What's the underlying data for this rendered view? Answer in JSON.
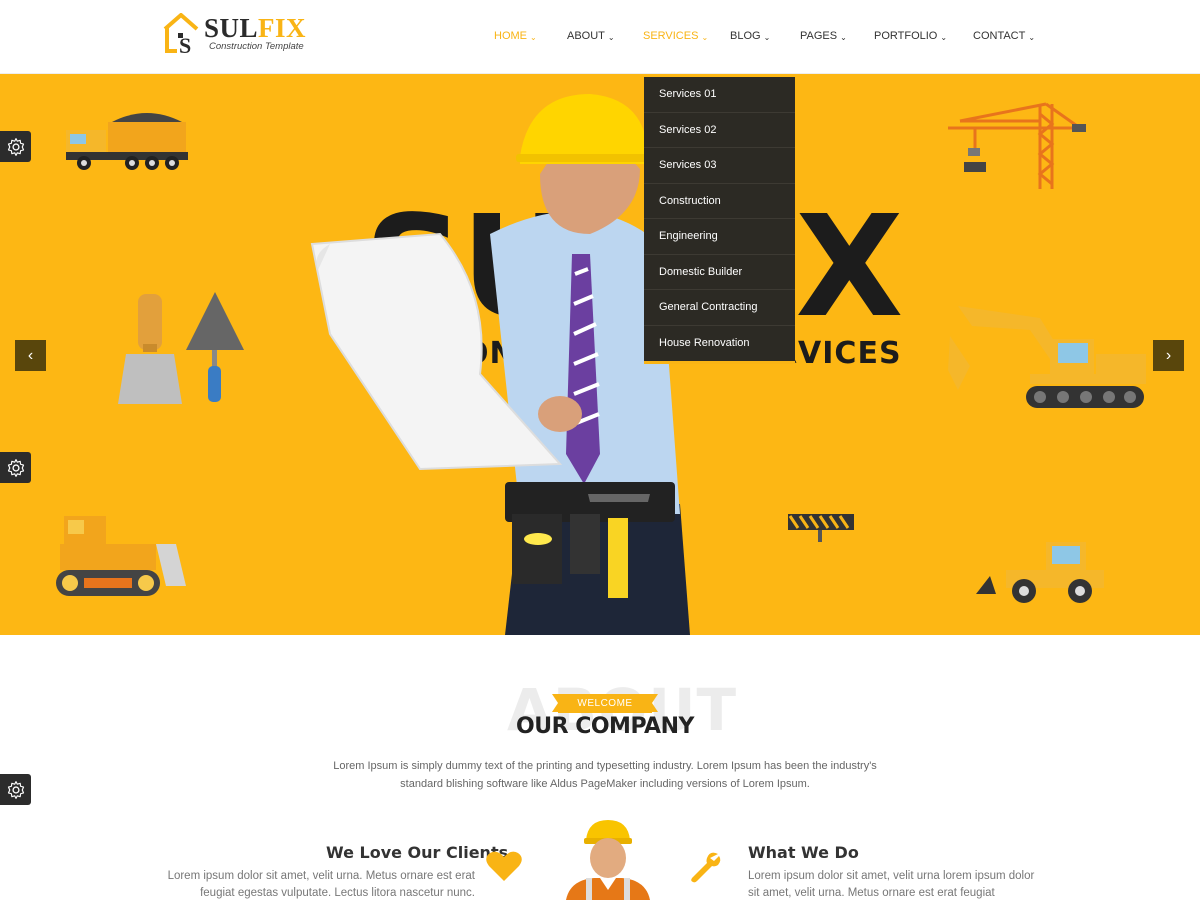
{
  "brand": {
    "name_part1": "SUL",
    "name_part2": "FIX",
    "tagline": "Construction Template"
  },
  "nav": {
    "items": [
      {
        "label": "HOME",
        "active": true
      },
      {
        "label": "ABOUT",
        "active": false
      },
      {
        "label": "SERVICES",
        "active": true
      },
      {
        "label": "BLOG",
        "active": false
      },
      {
        "label": "PAGES",
        "active": false
      },
      {
        "label": "PORTFOLIO",
        "active": false
      },
      {
        "label": "CONTACT",
        "active": false
      }
    ]
  },
  "dropdown": {
    "items": [
      "Services 01",
      "Services 02",
      "Services 03",
      "Construction",
      "Engineering",
      "Domestic Builder",
      "General Contracting",
      "House Renovation"
    ]
  },
  "hero": {
    "big_word": "SULFIX",
    "sub_word": "CONSTRUCTION SERVICES",
    "prev_icon": "chevron-left-icon",
    "next_icon": "chevron-right-icon"
  },
  "about": {
    "bg_word": "ABOUT",
    "welcome": "WELCOME",
    "title": "OUR COMPANY",
    "description": "Lorem Ipsum is simply dummy text of the printing and typesetting industry. Lorem Ipsum has been the industry's standard blishing software like Aldus PageMaker including versions of Lorem Ipsum."
  },
  "features": {
    "left": {
      "title": "We Love Our Clients",
      "text": "Lorem ipsum dolor sit amet, velit urna. Metus ornare est erat feugiat egestas vulputate. Lectus litora nascetur nunc.",
      "icon": "heart-icon"
    },
    "right": {
      "title": "What We Do",
      "text": "Lorem ipsum dolor sit amet, velit urna lorem ipsum dolor sit amet, velit urna. Metus ornare est erat feugiat",
      "icon": "wrench-icon"
    }
  },
  "colors": {
    "accent": "#f9b415",
    "hero_bg": "#fdb714",
    "dark": "#2c2a24"
  }
}
